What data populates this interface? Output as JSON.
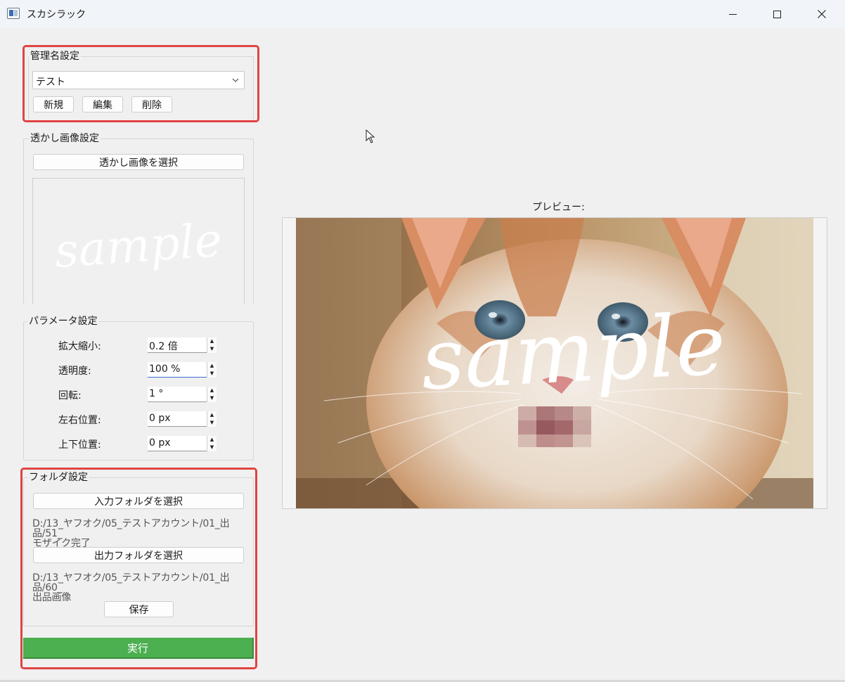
{
  "window": {
    "title": "スカシラック",
    "colors": {
      "accent_highlight": "#e04444",
      "run_button": "#4caf50"
    }
  },
  "admin_group": {
    "title": "管理名設定",
    "selected": "テスト",
    "buttons": {
      "new": "新規",
      "edit": "編集",
      "delete": "削除"
    }
  },
  "watermark_group": {
    "title": "透かし画像設定",
    "select_button": "透かし画像を選択",
    "image_text": "sample"
  },
  "params_group": {
    "title": "パラメータ設定",
    "scale_label": "拡大縮小:",
    "scale_value": "0.2 倍",
    "opacity_label": "透明度:",
    "opacity_value": "100 %",
    "rotation_label": "回転:",
    "rotation_value": "1 °",
    "horizontal_label": "左右位置:",
    "horizontal_value": "0 px",
    "vertical_label": "上下位置:",
    "vertical_value": "0 px"
  },
  "folder_group": {
    "title": "フォルダ設定",
    "input_button": "入力フォルダを選択",
    "input_path_line1": "D:/13_ヤフオク/05_テストアカウント/01_出品/51_",
    "input_path_line2": "モザイク完了",
    "output_button": "出力フォルダを選択",
    "output_path_line1": "D:/13_ヤフオク/05_テストアカウント/01_出品/60_",
    "output_path_line2": "出品画像",
    "save_button": "保存"
  },
  "run_button": "実行",
  "preview": {
    "label": "プレビュー:",
    "watermark_text": "sample"
  }
}
